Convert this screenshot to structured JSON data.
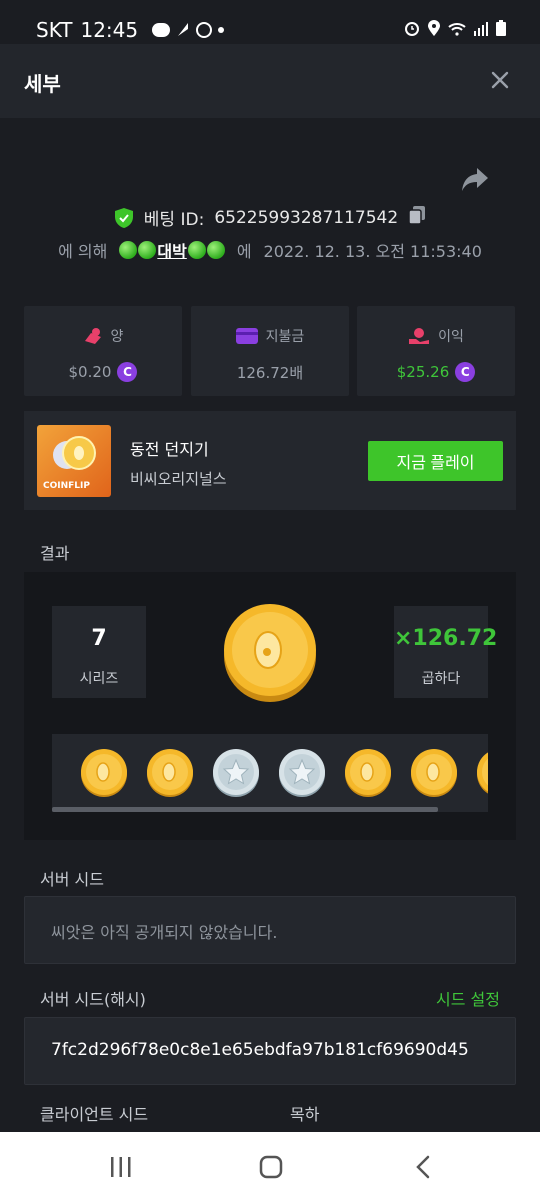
{
  "status_bar": {
    "carrier": "SKT",
    "time": "12:45"
  },
  "header": {
    "title": "세부"
  },
  "bet": {
    "id_label": "베팅 ID:",
    "id_value": "65225993287117542",
    "by_label": "에 의해",
    "username": "대박",
    "at_label": "에",
    "datetime": "2022. 12. 13. 오전 11:53:40"
  },
  "stats": {
    "amount": {
      "label": "양",
      "value": "$0.20"
    },
    "payout": {
      "label": "지불금",
      "value": "126.72배"
    },
    "profit": {
      "label": "이익",
      "value": "$25.26"
    }
  },
  "game": {
    "thumb_label": "COINFLIP",
    "name": "동전 던지기",
    "provider": "비씨오리지널스",
    "play_label": "지금 플레이"
  },
  "result": {
    "section_label": "결과",
    "series_value": "7",
    "series_label": "시리즈",
    "multiplier_value": "×126.72",
    "multiplier_label": "곱하다",
    "coin_sequence": [
      "gold",
      "gold",
      "silver",
      "silver",
      "gold",
      "gold",
      "gold"
    ]
  },
  "server_seed": {
    "label": "서버 시드",
    "placeholder": "씨앗은 아직 공개되지 않았습니다."
  },
  "server_seed_hash": {
    "label": "서버 시드(해시)",
    "set_label": "시드 설정",
    "value": "7fc2d296f78e0c8e1e65ebdfa97b181cf69690d45"
  },
  "client_seed": {
    "label": "클라이언트 시드",
    "nonce_label": "목하"
  },
  "colors": {
    "accent_green": "#3ec52a",
    "coin_purple": "#8a3fe0",
    "background": "#1b1d22"
  }
}
